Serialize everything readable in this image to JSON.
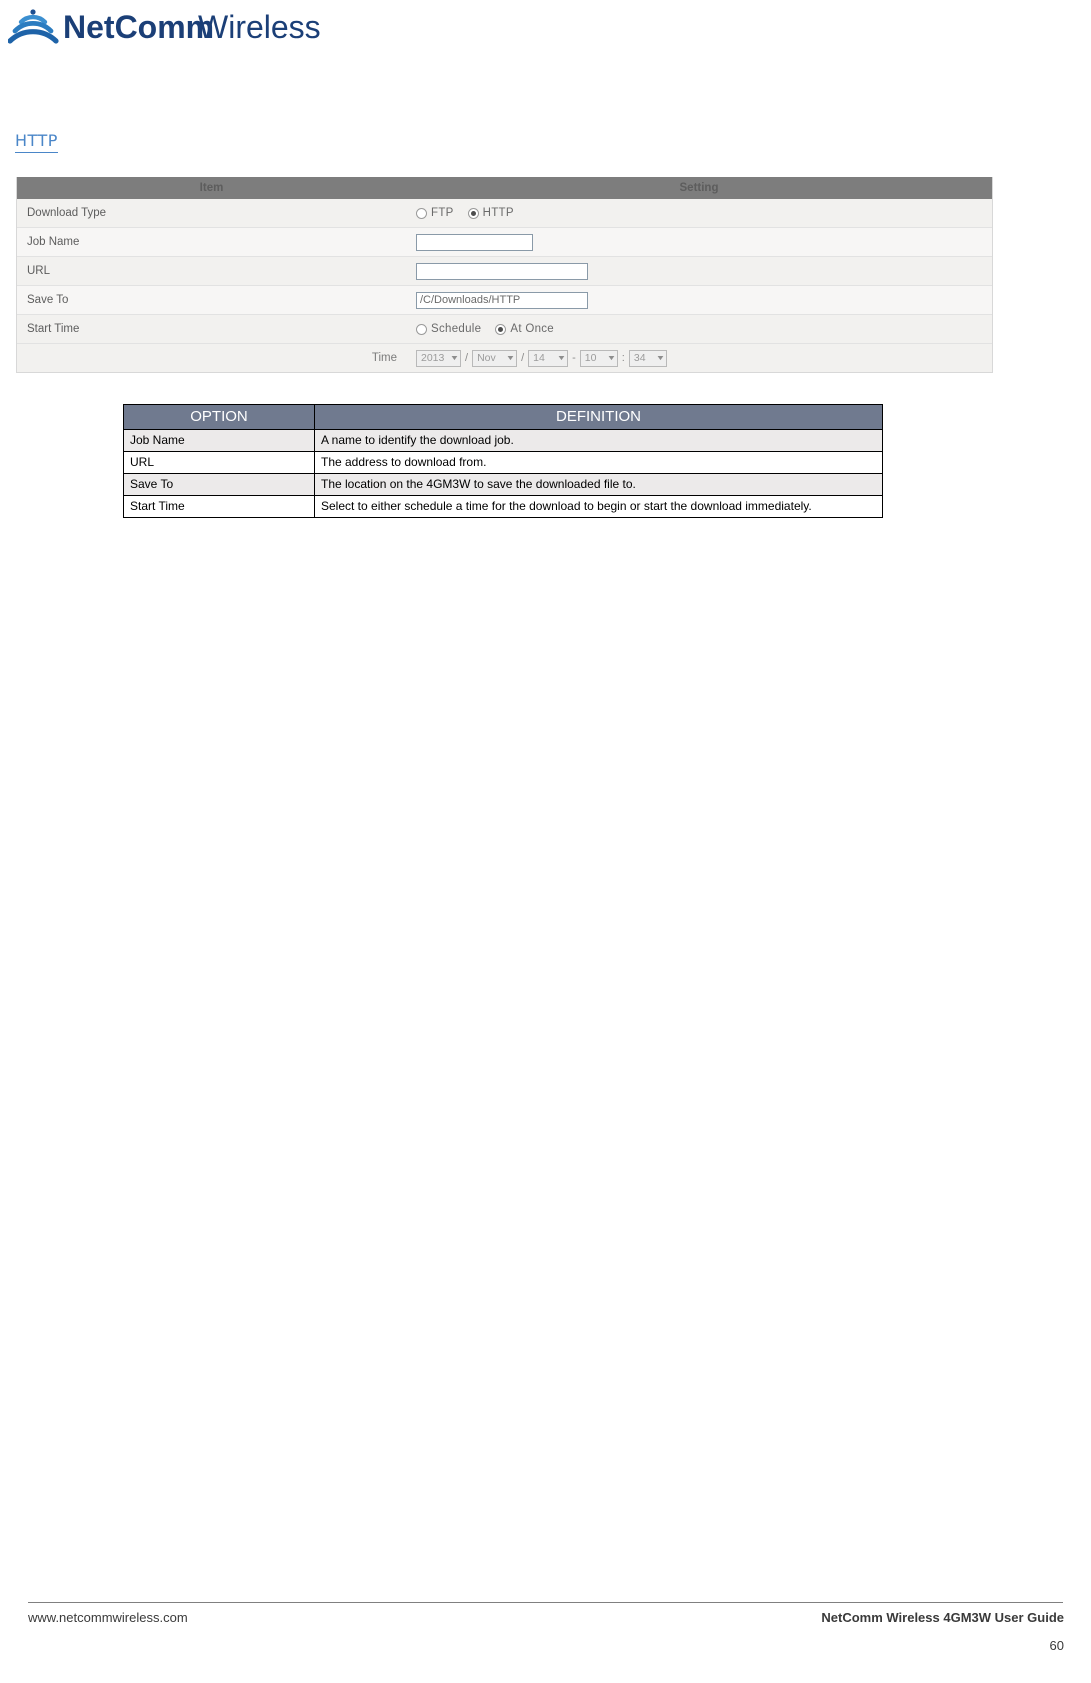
{
  "brand": {
    "logo_text_primary": "NetComm",
    "logo_text_secondary": "Wireless",
    "logo_icon": "wifi-signal-icon"
  },
  "section": {
    "heading": "HTTP"
  },
  "ui_form": {
    "header": {
      "item": "Item",
      "setting": "Setting"
    },
    "rows": [
      {
        "label": "Download Type",
        "options": [
          {
            "label": "FTP",
            "checked": false
          },
          {
            "label": "HTTP",
            "checked": true
          }
        ]
      },
      {
        "label": "Job Name",
        "value": "",
        "placeholder": ""
      },
      {
        "label": "URL",
        "value": "",
        "placeholder": ""
      },
      {
        "label": "Save To",
        "value": "/C/Downloads/HTTP",
        "placeholder": ""
      },
      {
        "label": "Start Time",
        "options": [
          {
            "label": "Schedule",
            "checked": false
          },
          {
            "label": "At Once",
            "checked": true
          }
        ]
      }
    ],
    "time_row": {
      "label": "Time",
      "year": "2013",
      "month": "Nov",
      "day": "14",
      "hour": "10",
      "minute": "34",
      "sep_date": "/",
      "sep_dash": "-",
      "sep_colon": ":"
    }
  },
  "definitions": {
    "headers": {
      "option": "OPTION",
      "definition": "DEFINITION"
    },
    "rows": [
      {
        "option": "Job Name",
        "definition": "A name to identify the download job."
      },
      {
        "option": "URL",
        "definition": "The address to download from."
      },
      {
        "option": "Save To",
        "definition": "The location on the 4GM3W to save the downloaded file to."
      },
      {
        "option": "Start Time",
        "definition": "Select to either schedule a time for the download to begin or start the download immediately."
      }
    ]
  },
  "footer": {
    "website": "www.netcommwireless.com",
    "guide": "NetComm Wireless 4GM3W User Guide",
    "page_number": "60"
  }
}
